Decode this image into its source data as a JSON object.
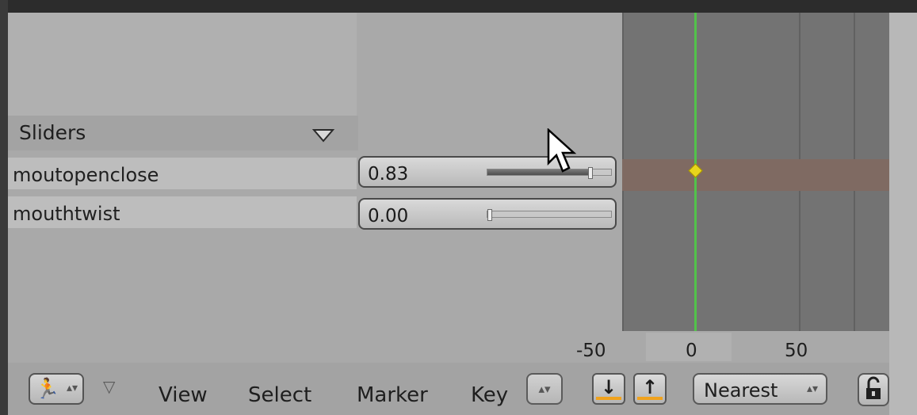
{
  "channels": {
    "header_label": "Sliders",
    "rows": [
      {
        "label": "moutopenclose",
        "value": "0.83",
        "fraction": 0.83
      },
      {
        "label": "mouthtwist",
        "value": "0.00",
        "fraction": 0.0
      }
    ]
  },
  "timeline": {
    "ruler_labels": [
      "-50",
      "0",
      "50"
    ],
    "current_frame": "0",
    "cursor_color": "#52c24a",
    "keyframe_color": "#e8d51c"
  },
  "toolbar": {
    "editor_type_icon": "running-figure-icon",
    "menus": [
      "View",
      "Select",
      "Marker",
      "Key"
    ],
    "snap_mode": "Nearest",
    "accent_color": "#f0a21d"
  }
}
